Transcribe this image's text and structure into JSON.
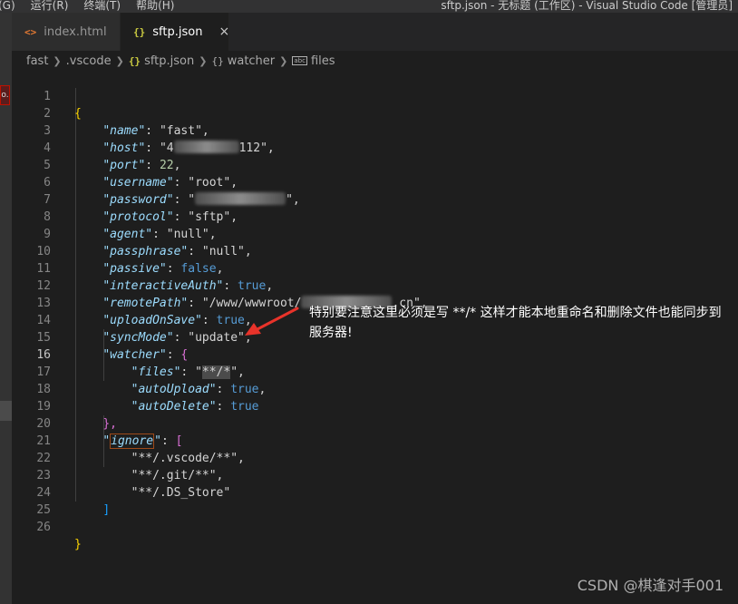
{
  "titlebar": {
    "menu": [
      "(G)",
      "运行(R)",
      "终端(T)",
      "帮助(H)"
    ],
    "window_title": "sftp.json - 无标题 (工作区) - Visual Studio Code [管理员]"
  },
  "activity": {
    "badge": "o."
  },
  "tabs": [
    {
      "icon": "<>",
      "label": "index.html",
      "active": false
    },
    {
      "icon": "{}",
      "label": "sftp.json",
      "active": true,
      "close": "×"
    }
  ],
  "breadcrumb": {
    "parts": [
      "fast",
      ".vscode",
      "sftp.json",
      "watcher",
      "files"
    ],
    "icons": [
      "{}",
      "{}",
      "abc"
    ]
  },
  "code": {
    "line_numbers": [
      "1",
      "2",
      "3",
      "4",
      "5",
      "6",
      "7",
      "8",
      "9",
      "10",
      "11",
      "12",
      "13",
      "14",
      "15",
      "16",
      "17",
      "18",
      "19",
      "20",
      "21",
      "22",
      "23",
      "24",
      "25",
      "26"
    ],
    "current_line": "16",
    "open_brace": "{",
    "close_brace": "}",
    "name_key": "\"name\"",
    "name_val": "\"fast\"",
    "host_key": "\"host\"",
    "host_val_a": "\"4",
    "host_val_b": "112\"",
    "port_key": "\"port\"",
    "port_val": "22",
    "username_key": "\"username\"",
    "username_val": "\"root\"",
    "password_key": "\"password\"",
    "password_val_a": "\"",
    "password_val_b": "\"",
    "protocol_key": "\"protocol\"",
    "protocol_val": "\"sftp\"",
    "agent_key": "\"agent\"",
    "agent_val": "\"null\"",
    "passphrase_key": "\"passphrase\"",
    "passphrase_val": "\"null\"",
    "passive_key": "\"passive\"",
    "passive_val": "false",
    "interactiveAuth_key": "\"interactiveAuth\"",
    "interactiveAuth_val": "true",
    "remotePath_key": "\"remotePath\"",
    "remotePath_val_a": "\"/www/wwwroot/",
    "remotePath_val_b": ".cn\"",
    "uploadOnSave_key": "\"uploadOnSave\"",
    "uploadOnSave_val": "true",
    "syncMode_key": "\"syncMode\"",
    "syncMode_val": "\"update\"",
    "watcher_key": "\"watcher\"",
    "files_key": "\"files\"",
    "files_val_a": "\"",
    "files_val_hl": "**/*",
    "files_val_b": "\"",
    "autoUpload_key": "\"autoUpload\"",
    "autoUpload_val": "true",
    "autoDelete_key": "\"autoDelete\"",
    "autoDelete_val": "true",
    "watcher_close": "},",
    "ignore_q1": "\"",
    "ignore_word": "ignore",
    "ignore_q2": "\"",
    "ignore_open": "[",
    "ignore_1": "\"**/.vscode/**\",",
    "ignore_2": "\"**/.git/**\",",
    "ignore_3": "\"**/.DS_Store\"",
    "ignore_close": "]"
  },
  "annotation": {
    "text": "特别要注意这里必须是写 **/* 这样才能本地重命名和删除文件也能同步到服务器!"
  },
  "watermark": "CSDN @棋逢对手001"
}
